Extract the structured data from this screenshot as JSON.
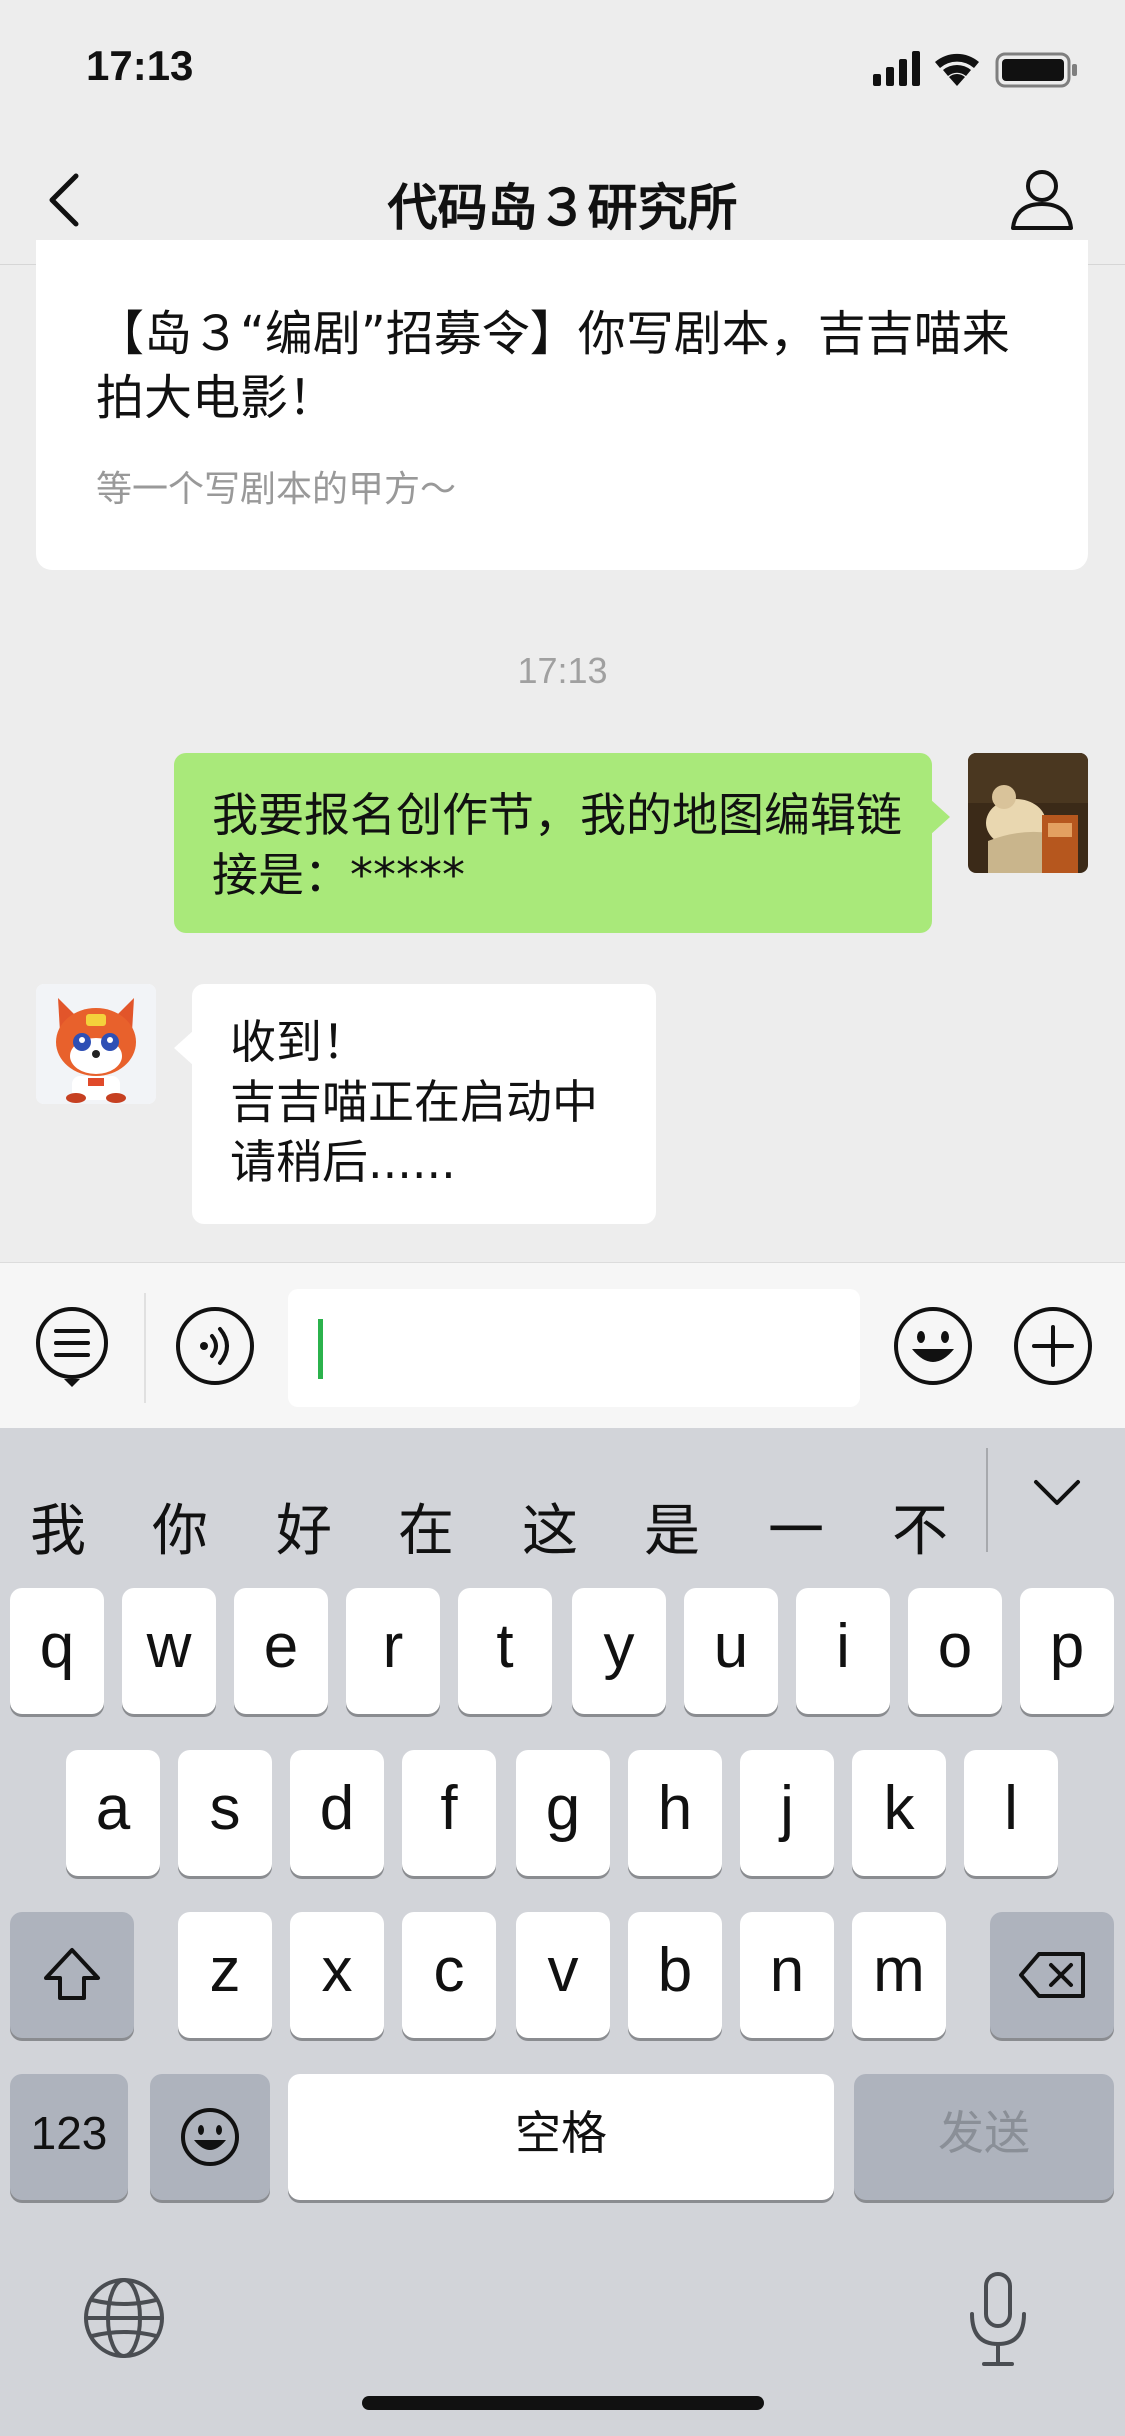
{
  "status_bar": {
    "time": "17:13"
  },
  "nav": {
    "title": "代码岛３研究所"
  },
  "chat": {
    "article": {
      "title": "【岛３“编剧”招募令】你写剧本，吉吉喵来拍大电影！",
      "subtitle": "等一个写剧本的甲方～"
    },
    "timestamp": "17:13",
    "outgoing_message": "我要报名创作节，我的地图编辑链接是：*****",
    "incoming_message_lines": [
      "收到！",
      "吉吉喵正在启动中",
      "请稍后......"
    ]
  },
  "input_bar": {
    "value": ""
  },
  "keyboard": {
    "candidates": [
      "我",
      "你",
      "好",
      "在",
      "这",
      "是",
      "一",
      "不"
    ],
    "row1": [
      "q",
      "w",
      "e",
      "r",
      "t",
      "y",
      "u",
      "i",
      "o",
      "p"
    ],
    "row2": [
      "a",
      "s",
      "d",
      "f",
      "g",
      "h",
      "j",
      "k",
      "l"
    ],
    "row3": [
      "z",
      "x",
      "c",
      "v",
      "b",
      "n",
      "m"
    ],
    "num_key": "123",
    "space_key": "空格",
    "send_key": "发送"
  },
  "colors": {
    "outgoing_bubble": "#a9e97a",
    "caret": "#2bb24c",
    "background": "#ededed"
  }
}
